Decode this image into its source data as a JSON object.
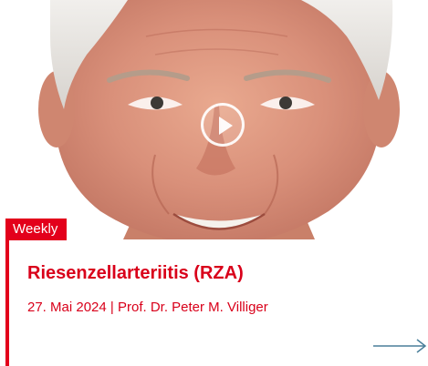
{
  "card": {
    "badge": "Weekly",
    "title": "Riesenzellarteriitis (RZA)",
    "date": "27. Mai 2024",
    "separator": "|",
    "author": "Prof. Dr. Peter M. Villiger"
  },
  "media": {
    "type": "video",
    "play_icon": "play-circle-icon"
  },
  "icons": {
    "arrow": "arrow-right-icon"
  },
  "colors": {
    "accent": "#e3001b",
    "title_text": "#d9001a",
    "arrow": "#4a7f9a"
  }
}
